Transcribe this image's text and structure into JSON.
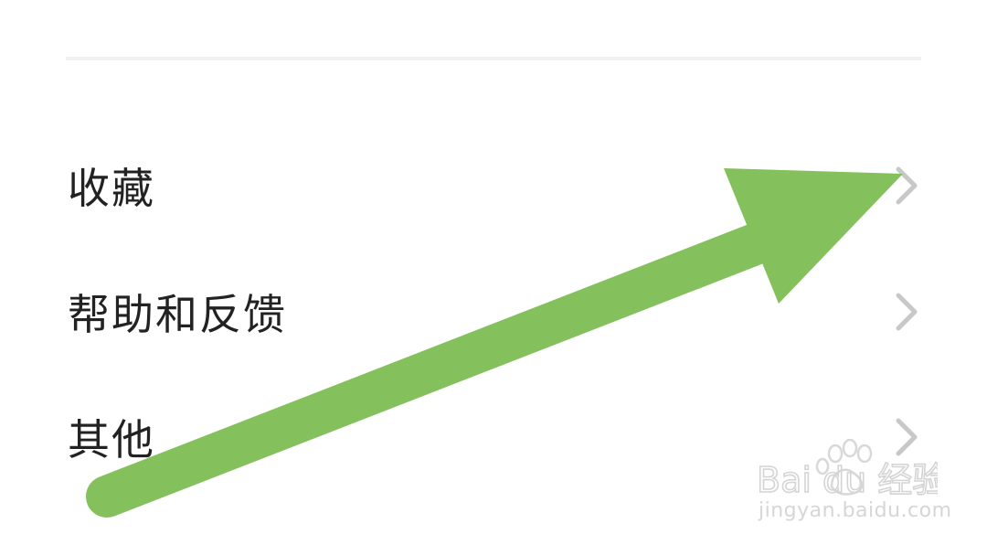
{
  "menu": {
    "items": [
      {
        "label": "收藏",
        "icon": "chevron-right-icon"
      },
      {
        "label": "帮助和反馈",
        "icon": "chevron-right-icon"
      },
      {
        "label": "其他",
        "icon": "chevron-right-icon"
      }
    ]
  },
  "annotation": {
    "icon": "arrow-annotation-icon",
    "color": "#84c05c"
  },
  "watermark": {
    "brand": "Bai du 经验",
    "url": "jingyan.baidu.com",
    "icon": "baidu-paw-icon"
  },
  "colors": {
    "text": "#222222",
    "chevron": "#c8c8c8",
    "divider": "#f2f2f2"
  }
}
